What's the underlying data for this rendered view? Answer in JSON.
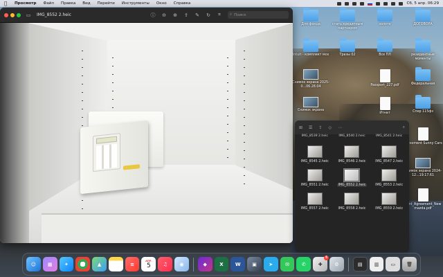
{
  "menubar": {
    "app_name": "Просмотр",
    "items": [
      "Файл",
      "Правка",
      "Вид",
      "Перейти",
      "Инструменты",
      "Окно",
      "Справка"
    ],
    "clock": "Сб, 5 апр.  06:29"
  },
  "preview": {
    "title": "IMG_8552 2.heic",
    "search_placeholder": "Поиск",
    "safe_badge": "● ●"
  },
  "desktop_icons": [
    {
      "label": "Для фонда",
      "kind": "folder"
    },
    {
      "label": "стать кредитным партнером",
      "kind": "folder"
    },
    {
      "label": "золото",
      "kind": "folder"
    },
    {
      "label": "ДОГОВОРА",
      "kind": "folder"
    },
    {
      "label": "Intuit - комплект мсе",
      "kind": "folder"
    },
    {
      "label": "Тразы 02",
      "kind": "folder"
    },
    {
      "label": "Все ПЛ",
      "kind": "folder"
    },
    {
      "label": "резидентные моменты",
      "kind": "folder"
    },
    {
      "label": "Снимок экрана 2025-0...06.28.04",
      "kind": "shot"
    },
    {
      "label": "Passport_227.pdf",
      "kind": "doc"
    },
    {
      "label": "Федеральная",
      "kind": "folder"
    },
    {
      "label": "Снимок экрана",
      "kind": "shot"
    },
    {
      "label": "Итнат",
      "kind": "doc"
    },
    {
      "label": "Спер 115фз",
      "kind": "folder"
    },
    {
      "label": "Agreement Sunny Cars",
      "kind": "doc"
    },
    {
      "label": "Снимок экрана 2024-12...19.17.61",
      "kind": "shot"
    },
    {
      "label": "Rent_Agreement_New mazda.pdf",
      "kind": "doc"
    }
  ],
  "finder": {
    "top_labels": [
      "IMG_8539 2.heic",
      "IMG_8540 2.heic",
      "IMG_8541 2.heic"
    ],
    "files": [
      {
        "name": "IMG_8545 2.heic",
        "selected": false
      },
      {
        "name": "IMG_8546 2.heic",
        "selected": false
      },
      {
        "name": "IMG_8547 2.heic",
        "selected": false
      },
      {
        "name": "IMG_8551 2.heic",
        "selected": false
      },
      {
        "name": "IMG_8552 2.heic",
        "selected": true
      },
      {
        "name": "IMG_8553 2.heic",
        "selected": false
      },
      {
        "name": "IMG_8557 2.heic",
        "selected": false
      },
      {
        "name": "IMG_8558 2.heic",
        "selected": false
      },
      {
        "name": "IMG_8559 2.heic",
        "selected": false
      }
    ]
  },
  "dock": {
    "calendar_day": "5",
    "calendar_month": "АПР.",
    "notification_badge": "5"
  },
  "colors": {
    "accent": "#4c9fe6",
    "traffic_red": "#ff5f57",
    "traffic_yellow": "#febc2e",
    "traffic_green": "#28c840"
  }
}
